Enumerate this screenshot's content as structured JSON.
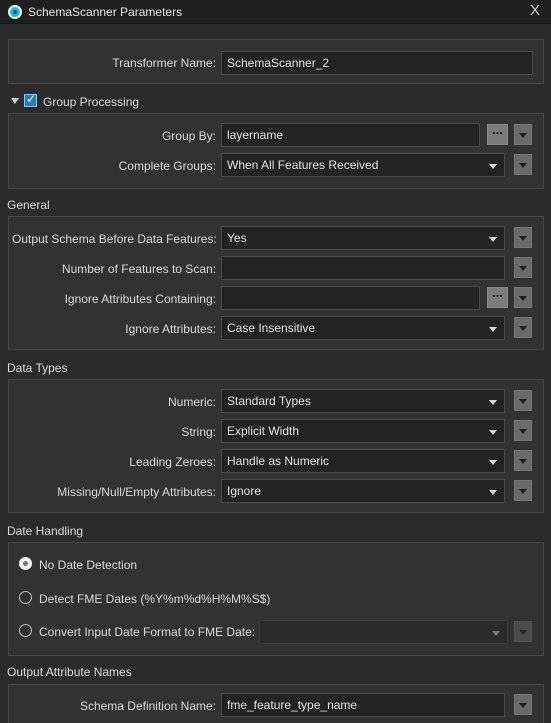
{
  "window": {
    "title": "SchemaScanner Parameters",
    "close_label": "X"
  },
  "transformer": {
    "label": "Transformer Name:",
    "value": "SchemaScanner_2"
  },
  "group_processing": {
    "label": "Group Processing",
    "checked": true,
    "group_by_label": "Group By:",
    "group_by_value": "layername",
    "complete_groups_label": "Complete Groups:",
    "complete_groups_value": "When All Features Received"
  },
  "general": {
    "title": "General",
    "output_schema_label": "Output Schema Before Data Features:",
    "output_schema_value": "Yes",
    "num_features_label": "Number of Features to Scan:",
    "num_features_value": "",
    "ignore_containing_label": "Ignore Attributes Containing:",
    "ignore_containing_value": "",
    "ignore_attributes_label": "Ignore Attributes:",
    "ignore_attributes_value": "Case Insensitive"
  },
  "data_types": {
    "title": "Data Types",
    "numeric_label": "Numeric:",
    "numeric_value": "Standard Types",
    "string_label": "String:",
    "string_value": "Explicit Width",
    "leading_zeroes_label": "Leading Zeroes:",
    "leading_zeroes_value": "Handle as Numeric",
    "missing_label": "Missing/Null/Empty Attributes:",
    "missing_value": "Ignore"
  },
  "date_handling": {
    "title": "Date Handling",
    "options": [
      {
        "label": "No Date Detection",
        "selected": true
      },
      {
        "label": "Detect FME Dates (%Y%m%d%H%M%S$)",
        "selected": false
      },
      {
        "label": "Convert Input Date Format to FME Date:",
        "selected": false
      }
    ],
    "convert_value": ""
  },
  "output_attribute_names": {
    "title": "Output Attribute Names",
    "schema_label": "Schema Definition Name:",
    "schema_value": "fme_feature_type_name"
  },
  "buttons": {
    "ellipsis": "..."
  },
  "icons": {
    "app": "app-icon",
    "close": "close-icon",
    "dropdown": "chevron-down-icon",
    "ellipsis": "ellipsis-icon"
  },
  "colors": {
    "background": "#2b2b2b",
    "panel": "#323232",
    "field": "#232323",
    "accent": "#2b7db4"
  }
}
